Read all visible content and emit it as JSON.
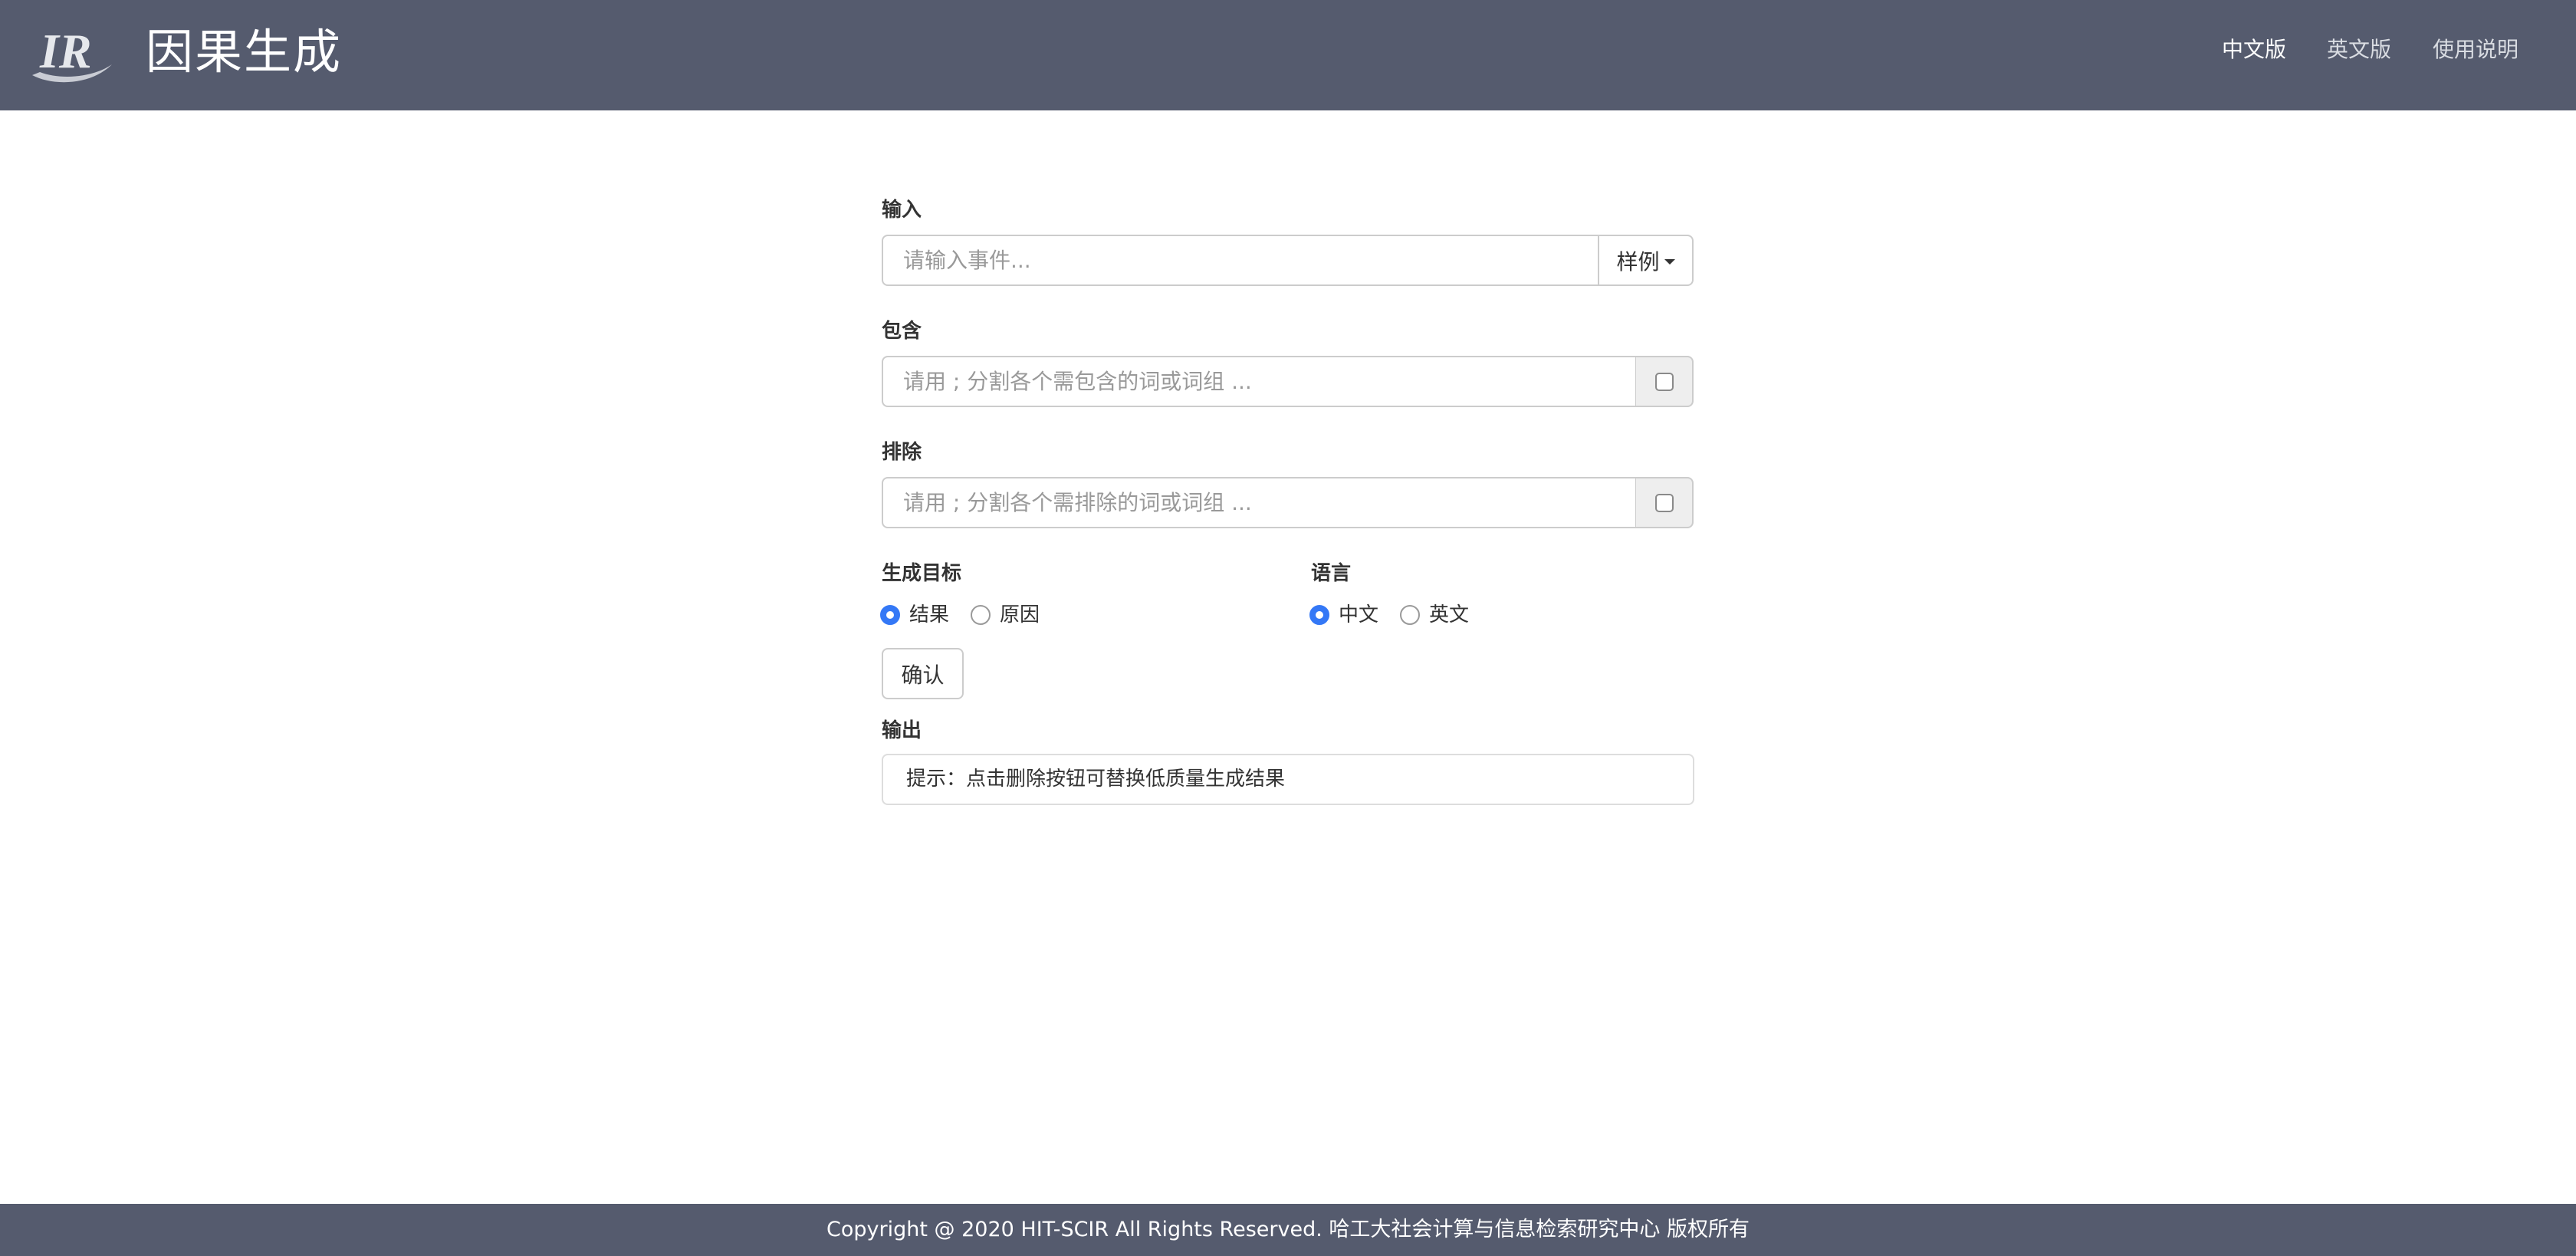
{
  "header": {
    "logo_text": "IR",
    "title": "因果生成",
    "nav": [
      {
        "label": "中文版",
        "active": true
      },
      {
        "label": "英文版",
        "active": false
      },
      {
        "label": "使用说明",
        "active": false
      }
    ]
  },
  "form": {
    "input": {
      "label": "输入",
      "placeholder": "请输入事件...",
      "value": "",
      "examples_button": "样例"
    },
    "include": {
      "label": "包含",
      "placeholder": "请用 ; 分割各个需包含的词或词组 ...",
      "value": "",
      "checked": false
    },
    "exclude": {
      "label": "排除",
      "placeholder": "请用 ; 分割各个需排除的词或词组 ...",
      "value": "",
      "checked": false
    },
    "target": {
      "label": "生成目标",
      "options": [
        "结果",
        "原因"
      ],
      "selected": "结果"
    },
    "language": {
      "label": "语言",
      "options": [
        "中文",
        "英文"
      ],
      "selected": "中文"
    },
    "confirm_button": "确认",
    "output": {
      "label": "输出",
      "hint": "提示：点击删除按钮可替换低质量生成结果"
    }
  },
  "footer": {
    "text": "Copyright @ 2020 HIT-SCIR All Rights Reserved. 哈工大社会计算与信息检索研究中心 版权所有"
  },
  "colors": {
    "navbar": "#555b6e",
    "radio_checked": "#3478f6",
    "addon_background": "#eeeeee"
  }
}
